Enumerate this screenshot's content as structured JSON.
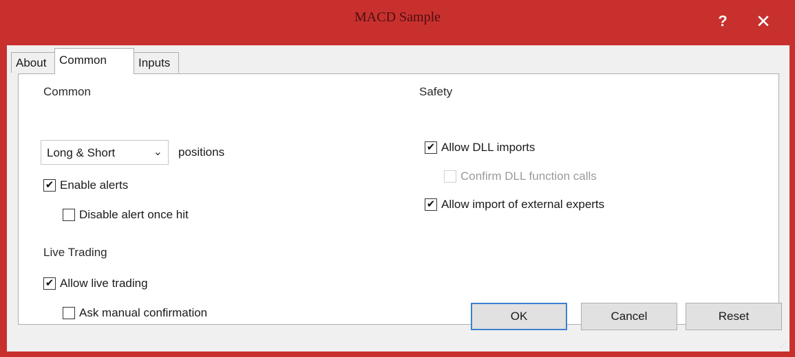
{
  "window": {
    "title": "MACD Sample",
    "help_label": "?",
    "close_label": "✕",
    "accent_color": "#c8302e"
  },
  "tabs": [
    {
      "label": "About",
      "active": false
    },
    {
      "label": "Common",
      "active": true
    },
    {
      "label": "Inputs",
      "active": false
    }
  ],
  "common": {
    "heading": "Common",
    "positions_select": {
      "value": "Long & Short",
      "arrow": "⌄"
    },
    "positions_label": "positions",
    "enable_alerts": {
      "label": "Enable alerts",
      "checked": true
    },
    "disable_alert_once_hit": {
      "label": "Disable alert once hit",
      "checked": false
    }
  },
  "live_trading": {
    "heading": "Live Trading",
    "allow_live_trading": {
      "label": "Allow live trading",
      "checked": true
    },
    "ask_manual_confirmation": {
      "label": "Ask manual confirmation",
      "checked": false
    }
  },
  "safety": {
    "heading": "Safety",
    "allow_dll_imports": {
      "label": "Allow DLL imports",
      "checked": true
    },
    "confirm_dll_function_calls": {
      "label": "Confirm DLL function calls",
      "checked": false,
      "disabled": true
    },
    "allow_import_external_experts": {
      "label": "Allow import of external experts",
      "checked": true
    }
  },
  "buttons": {
    "ok": "OK",
    "cancel": "Cancel",
    "reset": "Reset"
  },
  "check_glyph": "✔"
}
